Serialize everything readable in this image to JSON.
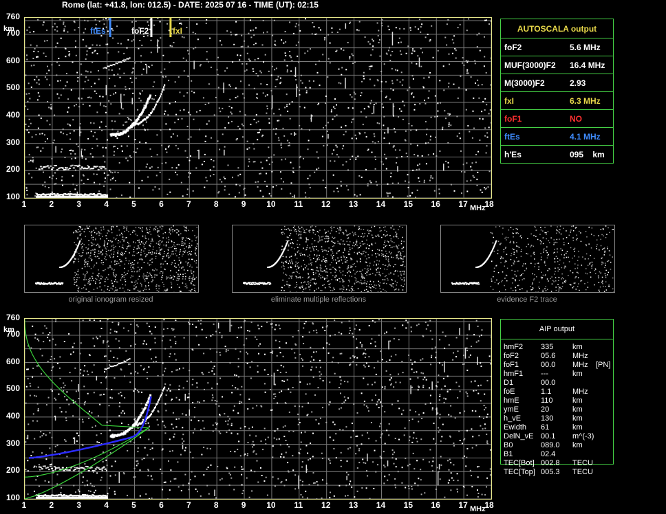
{
  "header": {
    "title": "Rome (lat: +41.8, lon: 012.5) - DATE: 2025 07 16 - TIME (UT): 02:15"
  },
  "axes": {
    "y_ticks": [
      "760",
      "700",
      "600",
      "500",
      "400",
      "300",
      "200",
      "100"
    ],
    "y_unit": "km",
    "x_ticks": [
      "1",
      "2",
      "3",
      "4",
      "5",
      "6",
      "7",
      "8",
      "9",
      "10",
      "11",
      "12",
      "13",
      "14",
      "15",
      "16",
      "17",
      "18"
    ],
    "x_unit": "MHz"
  },
  "top_markers": {
    "ftes": "ftEs",
    "fof2": "foF2",
    "fxl": "fxI"
  },
  "autoscala": {
    "title": "AUTOSCALA output",
    "rows": [
      {
        "label": "foF2",
        "value": "5.6 MHz",
        "color": "#ffffff"
      },
      {
        "label": "MUF(3000)F2",
        "value": "16.4 MHz",
        "color": "#ffffff"
      },
      {
        "label": "M(3000)F2",
        "value": "2.93",
        "color": "#ffffff"
      },
      {
        "label": "fxI",
        "value": "6.3 MHz",
        "color": "#e8d84a"
      },
      {
        "label": "foF1",
        "value": "NO",
        "color": "#ff3030"
      },
      {
        "label": "ftEs",
        "value": "4.1 MHz",
        "color": "#3f8cff"
      },
      {
        "label": "h'Es",
        "value": "095    km",
        "color": "#ffffff"
      }
    ]
  },
  "thumbnails": [
    {
      "caption": "original ionogram resized"
    },
    {
      "caption": "eliminate multiple reflections"
    },
    {
      "caption": "evidence F2 trace"
    }
  ],
  "aip": {
    "title": "AIP output",
    "rows": [
      {
        "name": "hmF2",
        "value": "335",
        "unit": "km",
        "extra": ""
      },
      {
        "name": "foF2",
        "value": "05.6",
        "unit": "MHz",
        "extra": ""
      },
      {
        "name": "foF1",
        "value": "00.0",
        "unit": "MHz",
        "extra": "[PN]"
      },
      {
        "name": "hmF1",
        "value": "---",
        "unit": "km",
        "extra": ""
      },
      {
        "name": "D1",
        "value": "00.0",
        "unit": "",
        "extra": ""
      },
      {
        "name": "foE",
        "value": "1.1",
        "unit": "MHz",
        "extra": ""
      },
      {
        "name": "hmE",
        "value": "110",
        "unit": "km",
        "extra": ""
      },
      {
        "name": "ymE",
        "value": "20",
        "unit": "km",
        "extra": ""
      },
      {
        "name": "h_vE",
        "value": "130",
        "unit": "km",
        "extra": ""
      },
      {
        "name": "Ewidth",
        "value": "61",
        "unit": "km",
        "extra": ""
      },
      {
        "name": "DelN_vE",
        "value": "00.1",
        "unit": "m^(-3)",
        "extra": ""
      },
      {
        "name": "B0",
        "value": "089.0",
        "unit": "km",
        "extra": ""
      },
      {
        "name": "B1",
        "value": "02.4",
        "unit": "",
        "extra": ""
      },
      {
        "name": "TEC[Bot]",
        "value": "002.8",
        "unit": "TECU",
        "extra": ""
      },
      {
        "name": "TEC[Top]",
        "value": "005.3",
        "unit": "TECU",
        "extra": ""
      }
    ]
  },
  "colors": {
    "grid": "#7a7a7a",
    "frame": "#e6e68a",
    "panel": "#45d145",
    "ftes": "#3f8cff",
    "fxl": "#e8d84a",
    "profile": "#3ad23a",
    "fit": "#2b2bff"
  }
}
